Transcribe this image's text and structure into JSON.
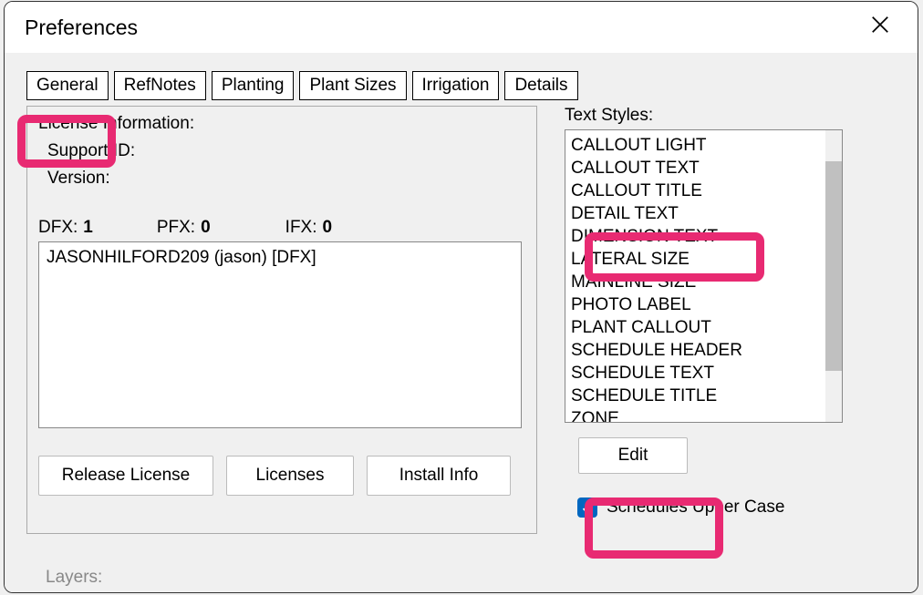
{
  "window": {
    "title": "Preferences"
  },
  "tabs": {
    "general": "General",
    "refnotes": "RefNotes",
    "planting": "Planting",
    "plant_sizes": "Plant Sizes",
    "irrigation": "Irrigation",
    "details": "Details"
  },
  "license": {
    "section_label": "License Information:",
    "support_id_label": "Support ID:",
    "version_label": "Version:",
    "dfx_label": "DFX:",
    "dfx_value": "1",
    "pfx_label": "PFX:",
    "pfx_value": "0",
    "ifx_label": "IFX:",
    "ifx_value": "0",
    "license_entry": "JASONHILFORD209 (jason) [DFX]",
    "release_button": "Release License",
    "licenses_button": "Licenses",
    "install_button": "Install Info"
  },
  "text_styles": {
    "label": "Text Styles:",
    "items": [
      "CALLOUT LIGHT",
      "CALLOUT TEXT",
      "CALLOUT TITLE",
      "DETAIL TEXT",
      "DIMENSION TEXT",
      "LATERAL SIZE",
      "MAINLINE SIZE",
      "PHOTO LABEL",
      "PLANT CALLOUT",
      "SCHEDULE HEADER",
      "SCHEDULE TEXT",
      "SCHEDULE TITLE",
      "ZONE"
    ],
    "edit_button": "Edit",
    "schedules_upper_case": "Schedules Upper Case"
  },
  "layers_label": "Layers:"
}
